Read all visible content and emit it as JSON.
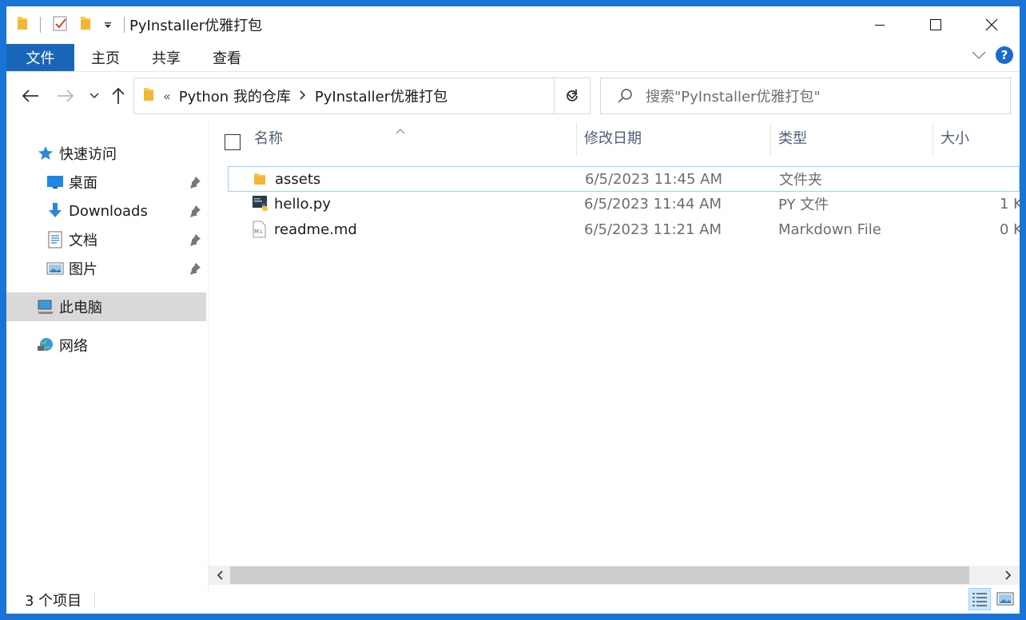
{
  "window": {
    "title": "PyInstaller优雅打包"
  },
  "ribbon": {
    "tabs": [
      {
        "label": "文件"
      },
      {
        "label": "主页"
      },
      {
        "label": "共享"
      },
      {
        "label": "查看"
      }
    ]
  },
  "address": {
    "overflow": "«",
    "crumbs": [
      {
        "label": "Python 我的仓库"
      },
      {
        "label": "PyInstaller优雅打包"
      }
    ]
  },
  "search": {
    "placeholder": "搜索\"PyInstaller优雅打包\""
  },
  "sidebar": {
    "quick_access": "快速访问",
    "pinned": [
      {
        "label": "桌面",
        "icon": "desktop-icon"
      },
      {
        "label": "Downloads",
        "icon": "download-icon"
      },
      {
        "label": "文档",
        "icon": "documents-icon"
      },
      {
        "label": "图片",
        "icon": "pictures-icon"
      }
    ],
    "this_pc": "此电脑",
    "network": "网络"
  },
  "columns": {
    "name": "名称",
    "date": "修改日期",
    "type": "类型",
    "size": "大小"
  },
  "files": [
    {
      "name": "assets",
      "date": "6/5/2023 11:45 AM",
      "type": "文件夹",
      "size": "",
      "icon": "folder-icon"
    },
    {
      "name": "hello.py",
      "date": "6/5/2023 11:44 AM",
      "type": "PY 文件",
      "size": "1 K",
      "icon": "python-file-icon"
    },
    {
      "name": "readme.md",
      "date": "6/5/2023 11:21 AM",
      "type": "Markdown File",
      "size": "0 K",
      "icon": "markdown-file-icon"
    }
  ],
  "status": {
    "item_count": "3 个项目"
  },
  "colors": {
    "accent": "#1966b8",
    "desktop_bg": "#1a74d6",
    "selection": "#cce8ff",
    "hover_border": "#99d1ff"
  }
}
